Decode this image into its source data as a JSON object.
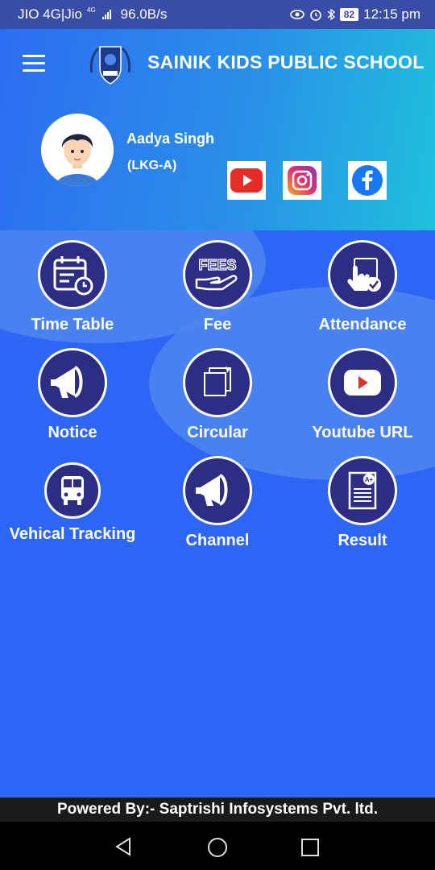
{
  "status_bar": {
    "carrier": "JIO 4G|Jio",
    "network_tag": "4G",
    "speed": "96.0B/s",
    "battery": "82",
    "time": "12:15 pm"
  },
  "header": {
    "school_name": "SAINIK KIDS PUBLIC SCHOOL",
    "student_name": "Aadya Singh",
    "student_class": "(LKG-A)"
  },
  "tiles": [
    {
      "label": "Time Table",
      "icon": "calendar-clock-icon"
    },
    {
      "label": "Fee",
      "icon": "fees-hand-icon"
    },
    {
      "label": "Attendance",
      "icon": "touch-check-icon"
    },
    {
      "label": "Notice",
      "icon": "megaphone-icon"
    },
    {
      "label": "Circular",
      "icon": "documents-icon"
    },
    {
      "label": "Youtube URL",
      "icon": "youtube-icon"
    },
    {
      "label": "Vehical Tracking",
      "icon": "bus-icon"
    },
    {
      "label": "Channel",
      "icon": "megaphone-icon"
    },
    {
      "label": "Result",
      "icon": "report-card-icon"
    }
  ],
  "footer": {
    "text": "Powered By:- Saptrishi Infosystems Pvt. ltd."
  },
  "colors": {
    "status_bar": "#3a4da6",
    "background": "#2d66f5",
    "tile_circle": "#2c2d83",
    "header_gradient_end": "#1fc0dc"
  }
}
